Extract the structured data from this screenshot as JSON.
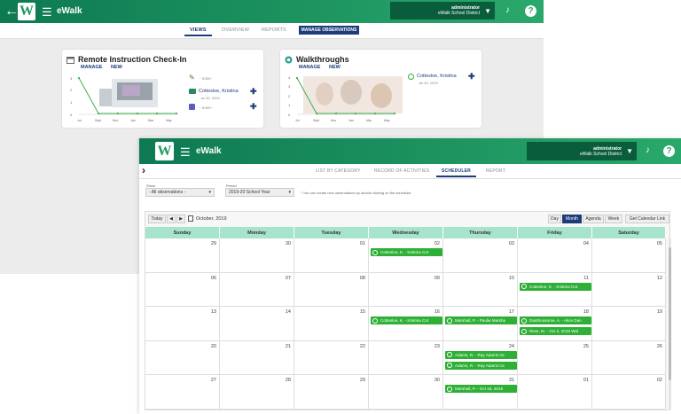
{
  "app": {
    "name": "eWalk",
    "logo_letter": "W"
  },
  "user": {
    "name": "administrator",
    "org": "eWalk School District"
  },
  "top_tabs": [
    {
      "label": "VIEWS",
      "active": true
    },
    {
      "label": "OVERVIEW",
      "active": false
    },
    {
      "label": "REPORTS",
      "active": false
    }
  ],
  "manage_button": "MANAGE OBSERVATIONS",
  "card_links": {
    "manage": "MANAGE",
    "new": "NEW"
  },
  "remote_card": {
    "title": "Remote Instruction Check-In",
    "y_ticks": [
      "3",
      "2",
      "1",
      "0"
    ],
    "x_ticks": [
      "Jul",
      "Sept",
      "Nov",
      "Jan",
      "Mar",
      "May"
    ],
    "entries": [
      {
        "text": "- none -",
        "sub": ""
      },
      {
        "text": "Cottesloe, Kristina",
        "sub": "Jul 30, 2020"
      },
      {
        "text": "- none -",
        "sub": ""
      }
    ]
  },
  "walk_card": {
    "title": "Walkthroughs",
    "y_ticks": [
      "4",
      "3",
      "2",
      "1",
      "0"
    ],
    "x_ticks": [
      "Jul",
      "Sept",
      "Nov",
      "Jan",
      "Mar",
      "May"
    ],
    "entry": {
      "text": "Cottesloe, Kristina",
      "sub": "Jul 30, 2020"
    }
  },
  "chart_data": [
    {
      "type": "line",
      "title": "Remote Instruction Check-In",
      "x": [
        "Jul",
        "Sept",
        "Nov",
        "Jan",
        "Mar",
        "May"
      ],
      "ylim": [
        0,
        3
      ],
      "series": [
        {
          "values": [
            3,
            0,
            0,
            0,
            0,
            0
          ]
        }
      ]
    },
    {
      "type": "line",
      "title": "Walkthroughs",
      "x": [
        "Jul",
        "Sept",
        "Nov",
        "Jan",
        "Mar",
        "May"
      ],
      "ylim": [
        0,
        4
      ],
      "series": [
        {
          "values": [
            4,
            0,
            0,
            0,
            0,
            0
          ]
        }
      ]
    }
  ],
  "sched_tabs": [
    {
      "label": "LIST BY CATEGORY",
      "active": false
    },
    {
      "label": "RECORD OF ACTIVITIES",
      "active": false
    },
    {
      "label": "SCHEDULER",
      "active": true
    },
    {
      "label": "REPORT",
      "active": false
    }
  ],
  "filters": {
    "show_label": "Show",
    "show_value": "- All observations -",
    "period_label": "Period",
    "period_value": "2019-20 School Year",
    "note": "* You can create new observations by double clicking on the scheduler"
  },
  "calendar": {
    "today": "Today",
    "month_label": "October, 2019",
    "views": [
      {
        "label": "Day",
        "active": false
      },
      {
        "label": "Month",
        "active": true
      },
      {
        "label": "Agenda",
        "active": false
      },
      {
        "label": "Week",
        "active": false
      }
    ],
    "link": "Get Calendar Link",
    "days": [
      "Sunday",
      "Monday",
      "Tuesday",
      "Wednesday",
      "Thursday",
      "Friday",
      "Saturday"
    ],
    "weeks": [
      [
        "29",
        "30",
        "01",
        "02",
        "03",
        "04",
        "05"
      ],
      [
        "06",
        "07",
        "08",
        "09",
        "10",
        "11",
        "12"
      ],
      [
        "13",
        "14",
        "15",
        "16",
        "17",
        "18",
        "19"
      ],
      [
        "20",
        "21",
        "22",
        "23",
        "24",
        "25",
        "26"
      ],
      [
        "27",
        "28",
        "29",
        "30",
        "31",
        "01",
        "02"
      ]
    ],
    "events": [
      {
        "week": 0,
        "day": 3,
        "slot": 0,
        "text": "Cottesloe, K. - Kristina Cot"
      },
      {
        "week": 1,
        "day": 5,
        "slot": 0,
        "text": "Cottesloe, K. - Kristina Cot"
      },
      {
        "week": 2,
        "day": 3,
        "slot": 0,
        "text": "Cottesloe, K. - Kristina Cot"
      },
      {
        "week": 2,
        "day": 4,
        "slot": 0,
        "text": "Marshall, P. - Paulie Marsha"
      },
      {
        "week": 2,
        "day": 5,
        "slot": 0,
        "text": "Danthousome, A. - Alice Dan"
      },
      {
        "week": 2,
        "day": 5,
        "slot": 1,
        "text": "River, M. - Oct 2, 2019 Wal"
      },
      {
        "week": 3,
        "day": 4,
        "slot": 0,
        "text": "Adams, R. - Ray Adams Oc"
      },
      {
        "week": 3,
        "day": 4,
        "slot": 1,
        "text": "Adams, R. - Ray Adams Oc"
      },
      {
        "week": 4,
        "day": 4,
        "slot": 0,
        "text": "Marshall, P. - Oct 18, 2019"
      }
    ]
  },
  "colors": {
    "header_green": "#1f9a5e",
    "accent_navy": "#1d3c7a",
    "event_green": "#2eb036",
    "day_header": "#a6e4cc"
  }
}
